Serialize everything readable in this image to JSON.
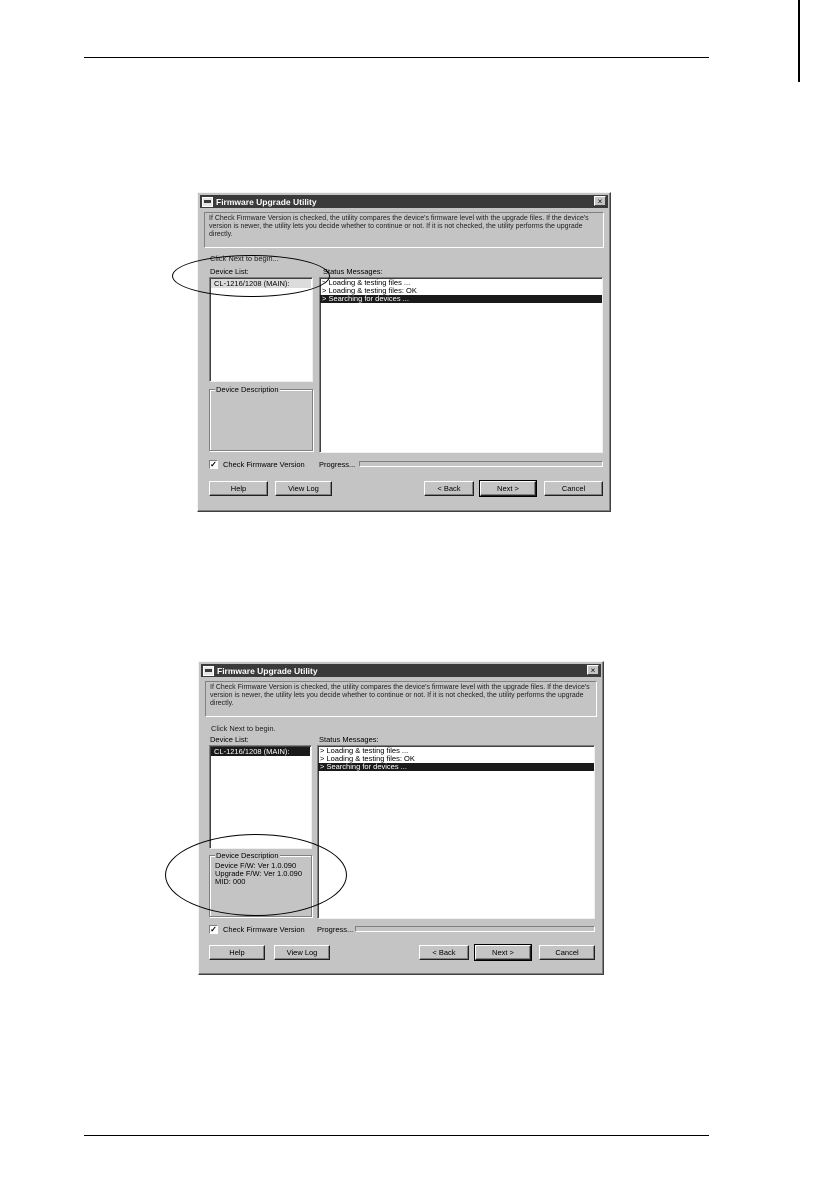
{
  "dialogs": [
    {
      "title": "Firmware Upgrade Utility",
      "close_glyph": "×",
      "info_text": "If Check Firmware Version is checked, the utility compares the device's firmware level with the upgrade files. If the device's version is newer, the utility lets you decide whether to continue or not. If it is not checked, the utility performs the upgrade directly.",
      "click_next": "Click Next to begin...",
      "device_list_label": "Device List:",
      "devices": [
        {
          "label": "CL-1216/1208 (MAIN):",
          "state": "unfocused"
        }
      ],
      "status_label": "Status Messages:",
      "status_messages": [
        {
          "text": "> Loading & testing files ...",
          "highlighted": false
        },
        {
          "text": "> Loading & testing files: OK",
          "highlighted": false
        },
        {
          "text": "> Searching for devices ...",
          "highlighted": true
        }
      ],
      "device_description": {
        "title": "Device Description",
        "lines": []
      },
      "check_firmware": {
        "label": "Check Firmware Version",
        "checked": true
      },
      "progress": {
        "label": "Progress...",
        "value": 0
      },
      "buttons": {
        "help": "Help",
        "view_log": "View Log",
        "back": "< Back",
        "next": "Next >",
        "cancel": "Cancel"
      }
    },
    {
      "title": "Firmware Upgrade Utility",
      "close_glyph": "×",
      "info_text": "If Check Firmware Version is checked, the utility compares the device's firmware level with the upgrade files. If the device's version is newer, the utility lets you decide whether to continue or not. If it is not checked, the utility performs the upgrade directly.",
      "click_next": "Click Next to begin.",
      "device_list_label": "Device List:",
      "devices": [
        {
          "label": "CL-1216/1208 (MAIN):",
          "state": "selected"
        }
      ],
      "status_label": "Status Messages:",
      "status_messages": [
        {
          "text": "> Loading & testing files ...",
          "highlighted": false
        },
        {
          "text": "> Loading & testing files: OK",
          "highlighted": false
        },
        {
          "text": "> Searching for devices ...",
          "highlighted": true
        }
      ],
      "device_description": {
        "title": "Device Description",
        "lines": [
          "Device F/W: Ver 1.0.090",
          "Upgrade F/W: Ver 1.0.090",
          "MID: 000"
        ]
      },
      "check_firmware": {
        "label": "Check Firmware Version",
        "checked": true
      },
      "progress": {
        "label": "Progress...",
        "value": 0
      },
      "buttons": {
        "help": "Help",
        "view_log": "View Log",
        "back": "< Back",
        "next": "Next >",
        "cancel": "Cancel"
      }
    }
  ],
  "check_glyph": "✓"
}
